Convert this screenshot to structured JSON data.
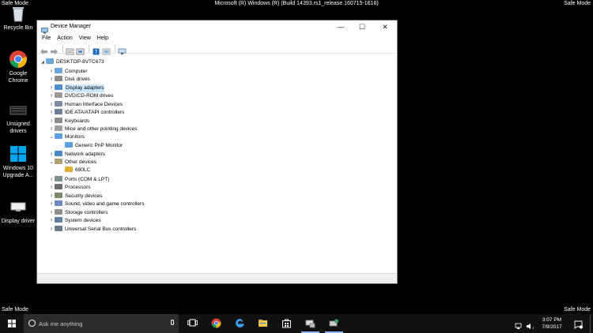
{
  "screen": {
    "safe_mode_label": "Safe Mode",
    "build_text": "Microsoft (R) Windows (R) (Build 14393.rs1_release.160715-1616)"
  },
  "desktop_icons": [
    {
      "label": "Recycle Bin",
      "icon": "recycle-bin-icon"
    },
    {
      "label": "Google Chrome",
      "icon": "chrome-icon"
    },
    {
      "label": "Unsigned drivers",
      "icon": "folder-icon"
    },
    {
      "label": "Windows 10 Upgrade A...",
      "icon": "windows-logo-icon"
    },
    {
      "label": "Display driver",
      "icon": "display-icon"
    }
  ],
  "window": {
    "title": "Device Manager",
    "menu": [
      "File",
      "Action",
      "View",
      "Help"
    ],
    "minimize": "—",
    "maximize": "☐",
    "close": "✕"
  },
  "tree": {
    "root": "DESKTOP-8VTC673",
    "items": [
      {
        "label": "Computer",
        "depth": 1,
        "state": "collapsed",
        "icon": "computer-icon"
      },
      {
        "label": "Disk drives",
        "depth": 1,
        "state": "collapsed",
        "icon": "disk-icon"
      },
      {
        "label": "Display adapters",
        "depth": 1,
        "state": "collapsed",
        "icon": "display-adapter-icon",
        "selected": true
      },
      {
        "label": "DVD/CD-ROM drives",
        "depth": 1,
        "state": "collapsed",
        "icon": "dvd-icon"
      },
      {
        "label": "Human Interface Devices",
        "depth": 1,
        "state": "collapsed",
        "icon": "hid-icon"
      },
      {
        "label": "IDE ATA/ATAPI controllers",
        "depth": 1,
        "state": "collapsed",
        "icon": "ide-icon"
      },
      {
        "label": "Keyboards",
        "depth": 1,
        "state": "collapsed",
        "icon": "keyboard-icon"
      },
      {
        "label": "Mice and other pointing devices",
        "depth": 1,
        "state": "collapsed",
        "icon": "mouse-icon"
      },
      {
        "label": "Monitors",
        "depth": 1,
        "state": "expanded",
        "icon": "monitor-icon"
      },
      {
        "label": "Generic PnP Monitor",
        "depth": 2,
        "state": "leaf",
        "icon": "monitor-icon"
      },
      {
        "label": "Network adapters",
        "depth": 1,
        "state": "collapsed",
        "icon": "network-icon"
      },
      {
        "label": "Other devices",
        "depth": 1,
        "state": "expanded",
        "icon": "other-devices-icon"
      },
      {
        "label": "690LC",
        "depth": 2,
        "state": "leaf",
        "icon": "warning-device-icon"
      },
      {
        "label": "Ports (COM & LPT)",
        "depth": 1,
        "state": "collapsed",
        "icon": "ports-icon"
      },
      {
        "label": "Processors",
        "depth": 1,
        "state": "collapsed",
        "icon": "processor-icon"
      },
      {
        "label": "Security devices",
        "depth": 1,
        "state": "collapsed",
        "icon": "security-icon"
      },
      {
        "label": "Sound, video and game controllers",
        "depth": 1,
        "state": "collapsed",
        "icon": "sound-icon"
      },
      {
        "label": "Storage controllers",
        "depth": 1,
        "state": "collapsed",
        "icon": "storage-icon"
      },
      {
        "label": "System devices",
        "depth": 1,
        "state": "collapsed",
        "icon": "system-icon"
      },
      {
        "label": "Universal Serial Bus controllers",
        "depth": 1,
        "state": "collapsed",
        "icon": "usb-icon"
      }
    ]
  },
  "taskbar": {
    "search_placeholder": "Ask me anything",
    "time": "3:07 PM",
    "date": "7/9/2017"
  },
  "colors": {
    "accent": "#0078d7",
    "selection": "#cce8ff",
    "taskbar": "#111111"
  }
}
